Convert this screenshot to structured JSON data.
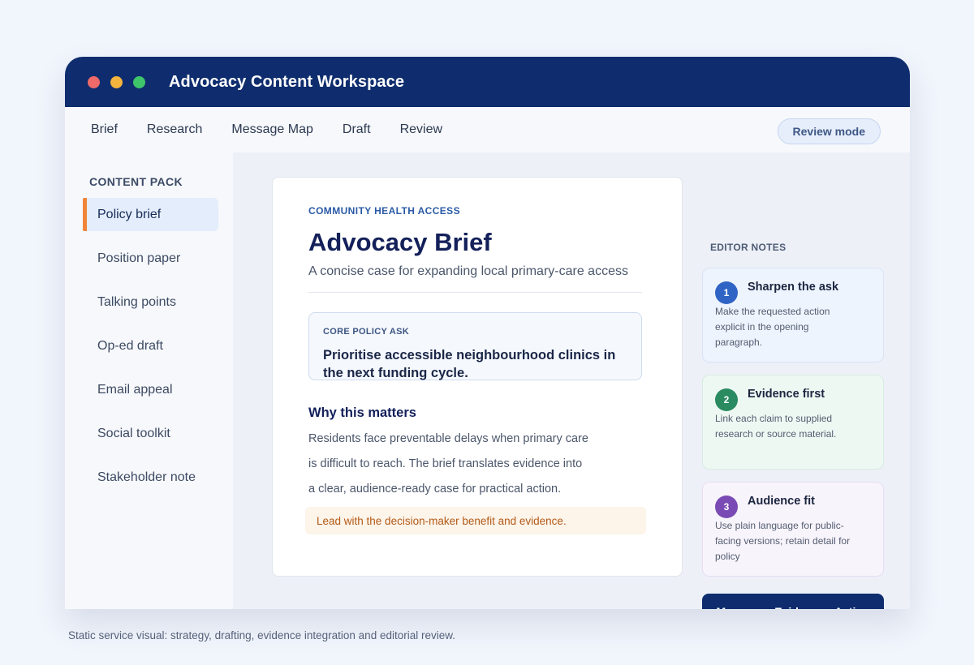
{
  "window": {
    "title": "Advocacy Content Workspace",
    "controls": [
      {
        "name": "close",
        "color": "#f06a6a"
      },
      {
        "name": "minimize",
        "color": "#f3b33d"
      },
      {
        "name": "maximize",
        "color": "#3fc56a"
      }
    ]
  },
  "nav": {
    "tabs": [
      {
        "label": "Brief"
      },
      {
        "label": "Research"
      },
      {
        "label": "Message Map"
      },
      {
        "label": "Draft"
      },
      {
        "label": "Review"
      }
    ],
    "mode_label": "Review mode"
  },
  "sidebar": {
    "heading": "CONTENT PACK",
    "active_index": 0,
    "accent_color": "#f0853a",
    "items": [
      {
        "label": "Policy brief"
      },
      {
        "label": "Position paper"
      },
      {
        "label": "Talking points"
      },
      {
        "label": "Op-ed draft"
      },
      {
        "label": "Email appeal"
      },
      {
        "label": "Social toolkit"
      },
      {
        "label": "Stakeholder note"
      }
    ]
  },
  "document": {
    "eyebrow": "COMMUNITY HEALTH ACCESS",
    "title": "Advocacy Brief",
    "subtitle": "A concise case for expanding local primary-care access",
    "ask_label": "CORE POLICY ASK",
    "ask_text": "Prioritise accessible neighbourhood clinics in the next funding cycle.",
    "section_title": "Why this matters",
    "body_lines": [
      "Residents face preventable delays when primary care",
      "is difficult to reach. The brief translates evidence into",
      "a clear, audience-ready case for practical action."
    ],
    "tip": "Lead with the decision-maker benefit and evidence."
  },
  "editor_notes": {
    "heading": "EDITOR NOTES",
    "notes": [
      {
        "number": "1",
        "title": "Sharpen the ask",
        "text": "Make the requested action explicit in the opening paragraph.",
        "color": "#2f64c4"
      },
      {
        "number": "2",
        "title": "Evidence first",
        "text": "Link each claim to supplied research or source material.",
        "color": "#2a8a60"
      },
      {
        "number": "3",
        "title": "Audience fit",
        "text": "Use plain language for public-facing versions; retain detail for policy",
        "color": "#7a4bb4"
      }
    ]
  },
  "cta": {
    "label": "Message • Evidence • Action"
  },
  "caption": "Static service visual: strategy, drafting, evidence integration and editorial review."
}
